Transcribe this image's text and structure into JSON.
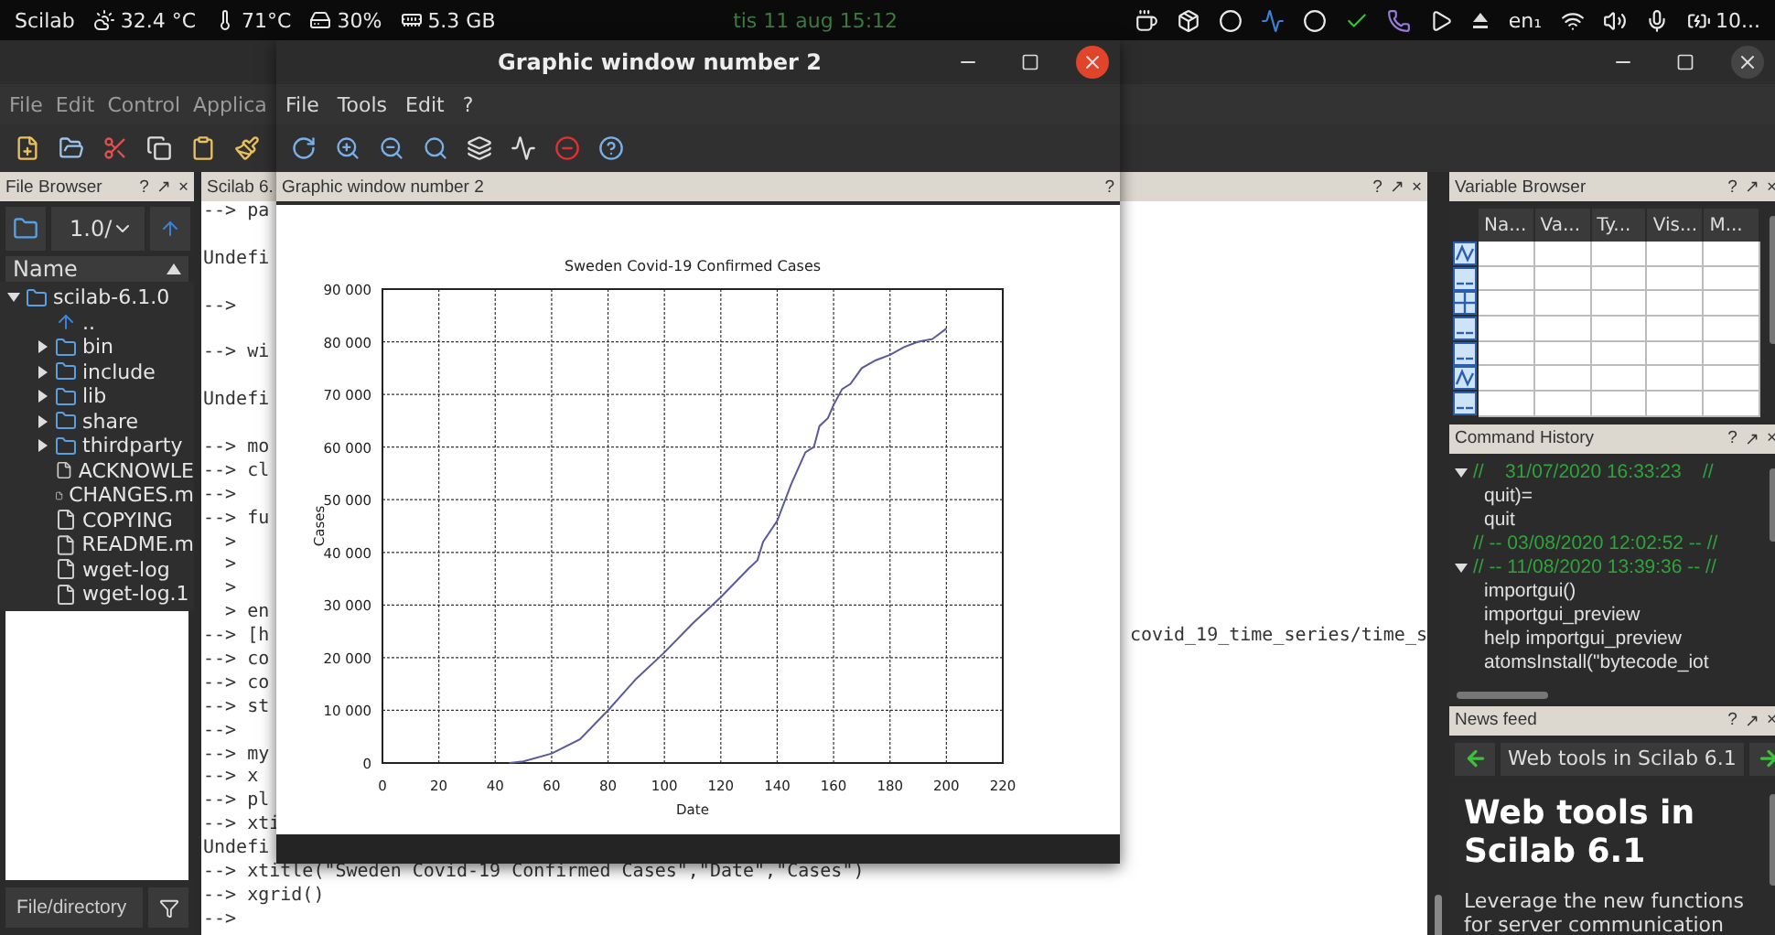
{
  "top_bar": {
    "app": "Scilab",
    "weather": "32.4 °C",
    "cpu_temp": "71°C",
    "disk": "30%",
    "memory": "5.3 GB",
    "clock": "tis 11 aug 15:12",
    "keyboard": "en₁",
    "battery": "10..."
  },
  "main_window": {
    "menu": [
      "File",
      "Edit",
      "Control",
      "Applica"
    ]
  },
  "file_browser": {
    "title": "File Browser",
    "controls": [
      "?",
      "↗",
      "×"
    ],
    "path": "1.0/",
    "column": "Name",
    "filter": "File/directory",
    "tree": [
      {
        "name": "scilab-6.1.0",
        "kind": "folder",
        "expanded": true,
        "children": [
          {
            "name": "..",
            "kind": "parent"
          },
          {
            "name": "bin",
            "kind": "folder",
            "expanded": false
          },
          {
            "name": "include",
            "kind": "folder",
            "expanded": false
          },
          {
            "name": "lib",
            "kind": "folder",
            "expanded": false
          },
          {
            "name": "share",
            "kind": "folder",
            "expanded": false
          },
          {
            "name": "thirdparty",
            "kind": "folder",
            "expanded": false
          },
          {
            "name": "ACKNOWLE",
            "kind": "file"
          },
          {
            "name": "CHANGES.m",
            "kind": "file"
          },
          {
            "name": "COPYING",
            "kind": "file"
          },
          {
            "name": "README.m",
            "kind": "file"
          },
          {
            "name": "wget-log",
            "kind": "file"
          },
          {
            "name": "wget-log.1",
            "kind": "file"
          }
        ]
      }
    ]
  },
  "console": {
    "title": "Scilab 6.",
    "controls": [
      "?",
      "↗",
      "×"
    ],
    "lines": [
      {
        "text": "--> pa",
        "spaced": false
      },
      {
        "text": "Undefi",
        "spaced": true
      },
      {
        "text": "-->",
        "spaced": true
      },
      {
        "text": "--> wi",
        "spaced": true
      },
      {
        "text": "Undefi",
        "spaced": true
      },
      {
        "text": "--> mo",
        "spaced": true
      },
      {
        "text": "--> cl",
        "spaced": false
      },
      {
        "text": "-->",
        "spaced": false
      },
      {
        "text": "--> fu",
        "spaced": false
      },
      {
        "text": "  >",
        "spaced": false
      },
      {
        "text": "  >",
        "spaced": false
      },
      {
        "text": "  >",
        "spaced": false
      },
      {
        "text": "  > en",
        "spaced": false
      },
      {
        "text": "--> [h",
        "spaced": false,
        "tail": "covid_19_time_series/time_s"
      },
      {
        "text": "--> co",
        "spaced": false
      },
      {
        "text": "--> co",
        "spaced": false
      },
      {
        "text": "--> st",
        "spaced": false
      },
      {
        "text": "-->",
        "spaced": false
      },
      {
        "text": "--> my",
        "spaced": false
      },
      {
        "text": "--> x",
        "spaced": false
      },
      {
        "text": "--> pl",
        "spaced": false
      },
      {
        "text": "--> xti",
        "spaced": false
      },
      {
        "text": "Undefi",
        "spaced": false
      },
      {
        "text": "--> xtitle(\"Sweden Covid-19 Confirmed Cases\",\"Date\",\"Cases\")",
        "spaced": false
      },
      {
        "text": "--> xgrid()",
        "spaced": false
      },
      {
        "text": "-->",
        "spaced": false
      }
    ]
  },
  "graphic_window": {
    "title": "Graphic window number 2",
    "menu": [
      "File",
      "Tools",
      "Edit",
      "?"
    ],
    "panel_title": "Graphic window number 2",
    "panel_controls": [
      "?"
    ],
    "chart_data": {
      "type": "line",
      "grid": true,
      "title": "Sweden Covid-19 Confirmed Cases",
      "xlabel": "Date",
      "ylabel": "Cases",
      "xlim": [
        0,
        220
      ],
      "ylim": [
        0,
        90000
      ],
      "xticks": [
        0,
        20,
        40,
        60,
        80,
        100,
        120,
        140,
        160,
        180,
        200,
        220
      ],
      "yticks": [
        {
          "value": 0,
          "label": "0"
        },
        {
          "value": 10000,
          "label": "10 000"
        },
        {
          "value": 20000,
          "label": "20 000"
        },
        {
          "value": 30000,
          "label": "30 000"
        },
        {
          "value": 40000,
          "label": "40 000"
        },
        {
          "value": 50000,
          "label": "50 000"
        },
        {
          "value": 60000,
          "label": "60 000"
        },
        {
          "value": 70000,
          "label": "70 000"
        },
        {
          "value": 80000,
          "label": "80 000"
        },
        {
          "value": 90000,
          "label": "90 000"
        }
      ],
      "x": [
        45,
        50,
        60,
        70,
        80,
        90,
        100,
        110,
        120,
        130,
        133,
        135,
        140,
        145,
        150,
        153,
        155,
        158,
        160,
        163,
        166,
        170,
        175,
        180,
        185,
        190,
        195,
        200
      ],
      "series": [
        {
          "color": "#5a5a9a",
          "values": [
            0,
            300,
            1800,
            4500,
            10000,
            16000,
            21000,
            26500,
            31500,
            37000,
            38500,
            42000,
            46000,
            53000,
            59000,
            60000,
            64000,
            65500,
            68000,
            71000,
            72000,
            75000,
            76500,
            77500,
            79000,
            80000,
            80500,
            82500
          ]
        }
      ]
    }
  },
  "variable_browser": {
    "title": "Variable Browser",
    "controls": [
      "?",
      "↗",
      "×"
    ],
    "columns": [
      "Na...",
      "Va...",
      "Ty...",
      "Vis...",
      "M..."
    ],
    "rows": [
      {
        "kind": "wave"
      },
      {
        "kind": "text"
      },
      {
        "kind": "grid"
      },
      {
        "kind": "text"
      },
      {
        "kind": "text"
      },
      {
        "kind": "wave"
      },
      {
        "kind": "text"
      }
    ]
  },
  "command_history": {
    "title": "Command History",
    "controls": [
      "?",
      "↗",
      "×"
    ],
    "sessions": [
      {
        "header": "//    31/07/2020 16:33:23    //",
        "expanded": true,
        "children": [
          {
            "text": "quit)="
          },
          {
            "text": "quit"
          }
        ]
      },
      {
        "header": "// -- 03/08/2020 12:02:52 -- //"
      },
      {
        "header": "// -- 11/08/2020 13:39:36 -- //",
        "expanded": true,
        "children": [
          {
            "text": "importgui()"
          },
          {
            "text": "importgui_preview"
          },
          {
            "text": "help importgui_preview"
          },
          {
            "text": "atomsInstall(\"bytecode_iot"
          }
        ]
      }
    ]
  },
  "news_feed": {
    "title": "News feed",
    "controls": [
      "?",
      "↗",
      "×"
    ],
    "nav_title": "Web tools in Scilab 6.1",
    "headline": "Web tools in Scilab 6.1",
    "body": "Leverage the new functions for server communication"
  }
}
